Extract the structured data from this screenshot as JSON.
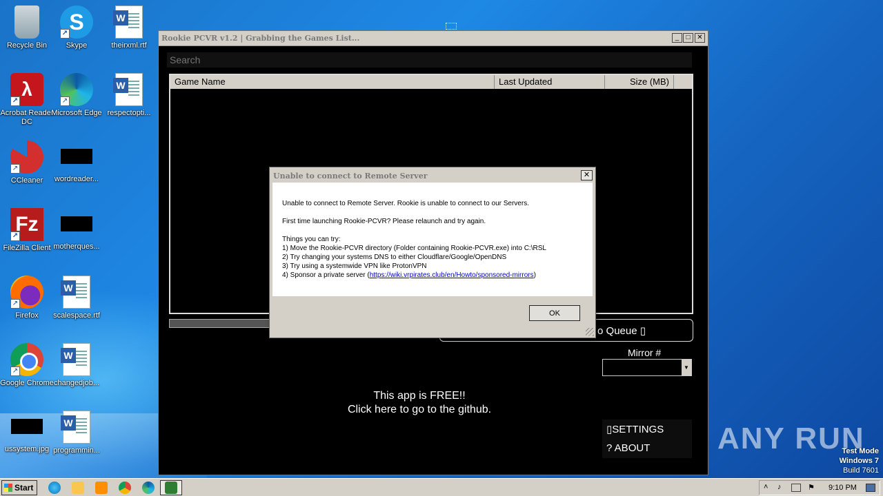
{
  "desktop": {
    "icons": [
      {
        "label": "Recycle Bin"
      },
      {
        "label": "Skype"
      },
      {
        "label": "theirxml.rtf"
      },
      {
        "label": "Acrobat Reader DC"
      },
      {
        "label": "Microsoft Edge"
      },
      {
        "label": "respectopti..."
      },
      {
        "label": "CCleaner"
      },
      {
        "label": "wordreader..."
      },
      {
        "label": "FileZilla Client"
      },
      {
        "label": "motherques..."
      },
      {
        "label": "Firefox"
      },
      {
        "label": "scalespace.rtf"
      },
      {
        "label": "Google Chrome"
      },
      {
        "label": "changedjob..."
      },
      {
        "label": "ussystem.jpg"
      },
      {
        "label": "programmin..."
      }
    ]
  },
  "app": {
    "title": "Rookie PCVR v1.2 | Grabbing the Games List...",
    "search_placeholder": "Search",
    "columns": [
      "Game Name",
      "Last Updated",
      "Size (MB)"
    ],
    "queue_label": "o Queue ▯",
    "mirror_label": "Mirror #",
    "free_line1": "This app is FREE!!",
    "free_line2": "Click here to go to the github.",
    "settings_label": "▯SETTINGS",
    "about_label": "?   ABOUT"
  },
  "dialog": {
    "title": "Unable to connect to Remote Server",
    "line1": "Unable to connect to Remote Server. Rookie is unable to connect to our Servers.",
    "line2": "First time launching Rookie-PCVR? Please relaunch and try again.",
    "line3": "Things you can try:",
    "tip1": "1) Move the Rookie-PCVR directory (Folder containing Rookie-PCVR.exe) into C:\\RSL",
    "tip2": "2) Try changing your systems DNS to either Cloudflare/Google/OpenDNS",
    "tip3": "3) Try using a systemwide VPN like ProtonVPN",
    "tip4_prefix": "4) Sponsor a private server (",
    "tip4_link": "https://wiki.vrpirates.club/en/Howto/sponsored-mirrors",
    "tip4_suffix": ")",
    "ok_label": "OK"
  },
  "watermark": "ANY RUN",
  "sysinfo": {
    "line1": "Test Mode",
    "line2": "Windows 7",
    "line3": "Build 7601"
  },
  "taskbar": {
    "start_label": "Start",
    "clock": "9:10 PM"
  }
}
